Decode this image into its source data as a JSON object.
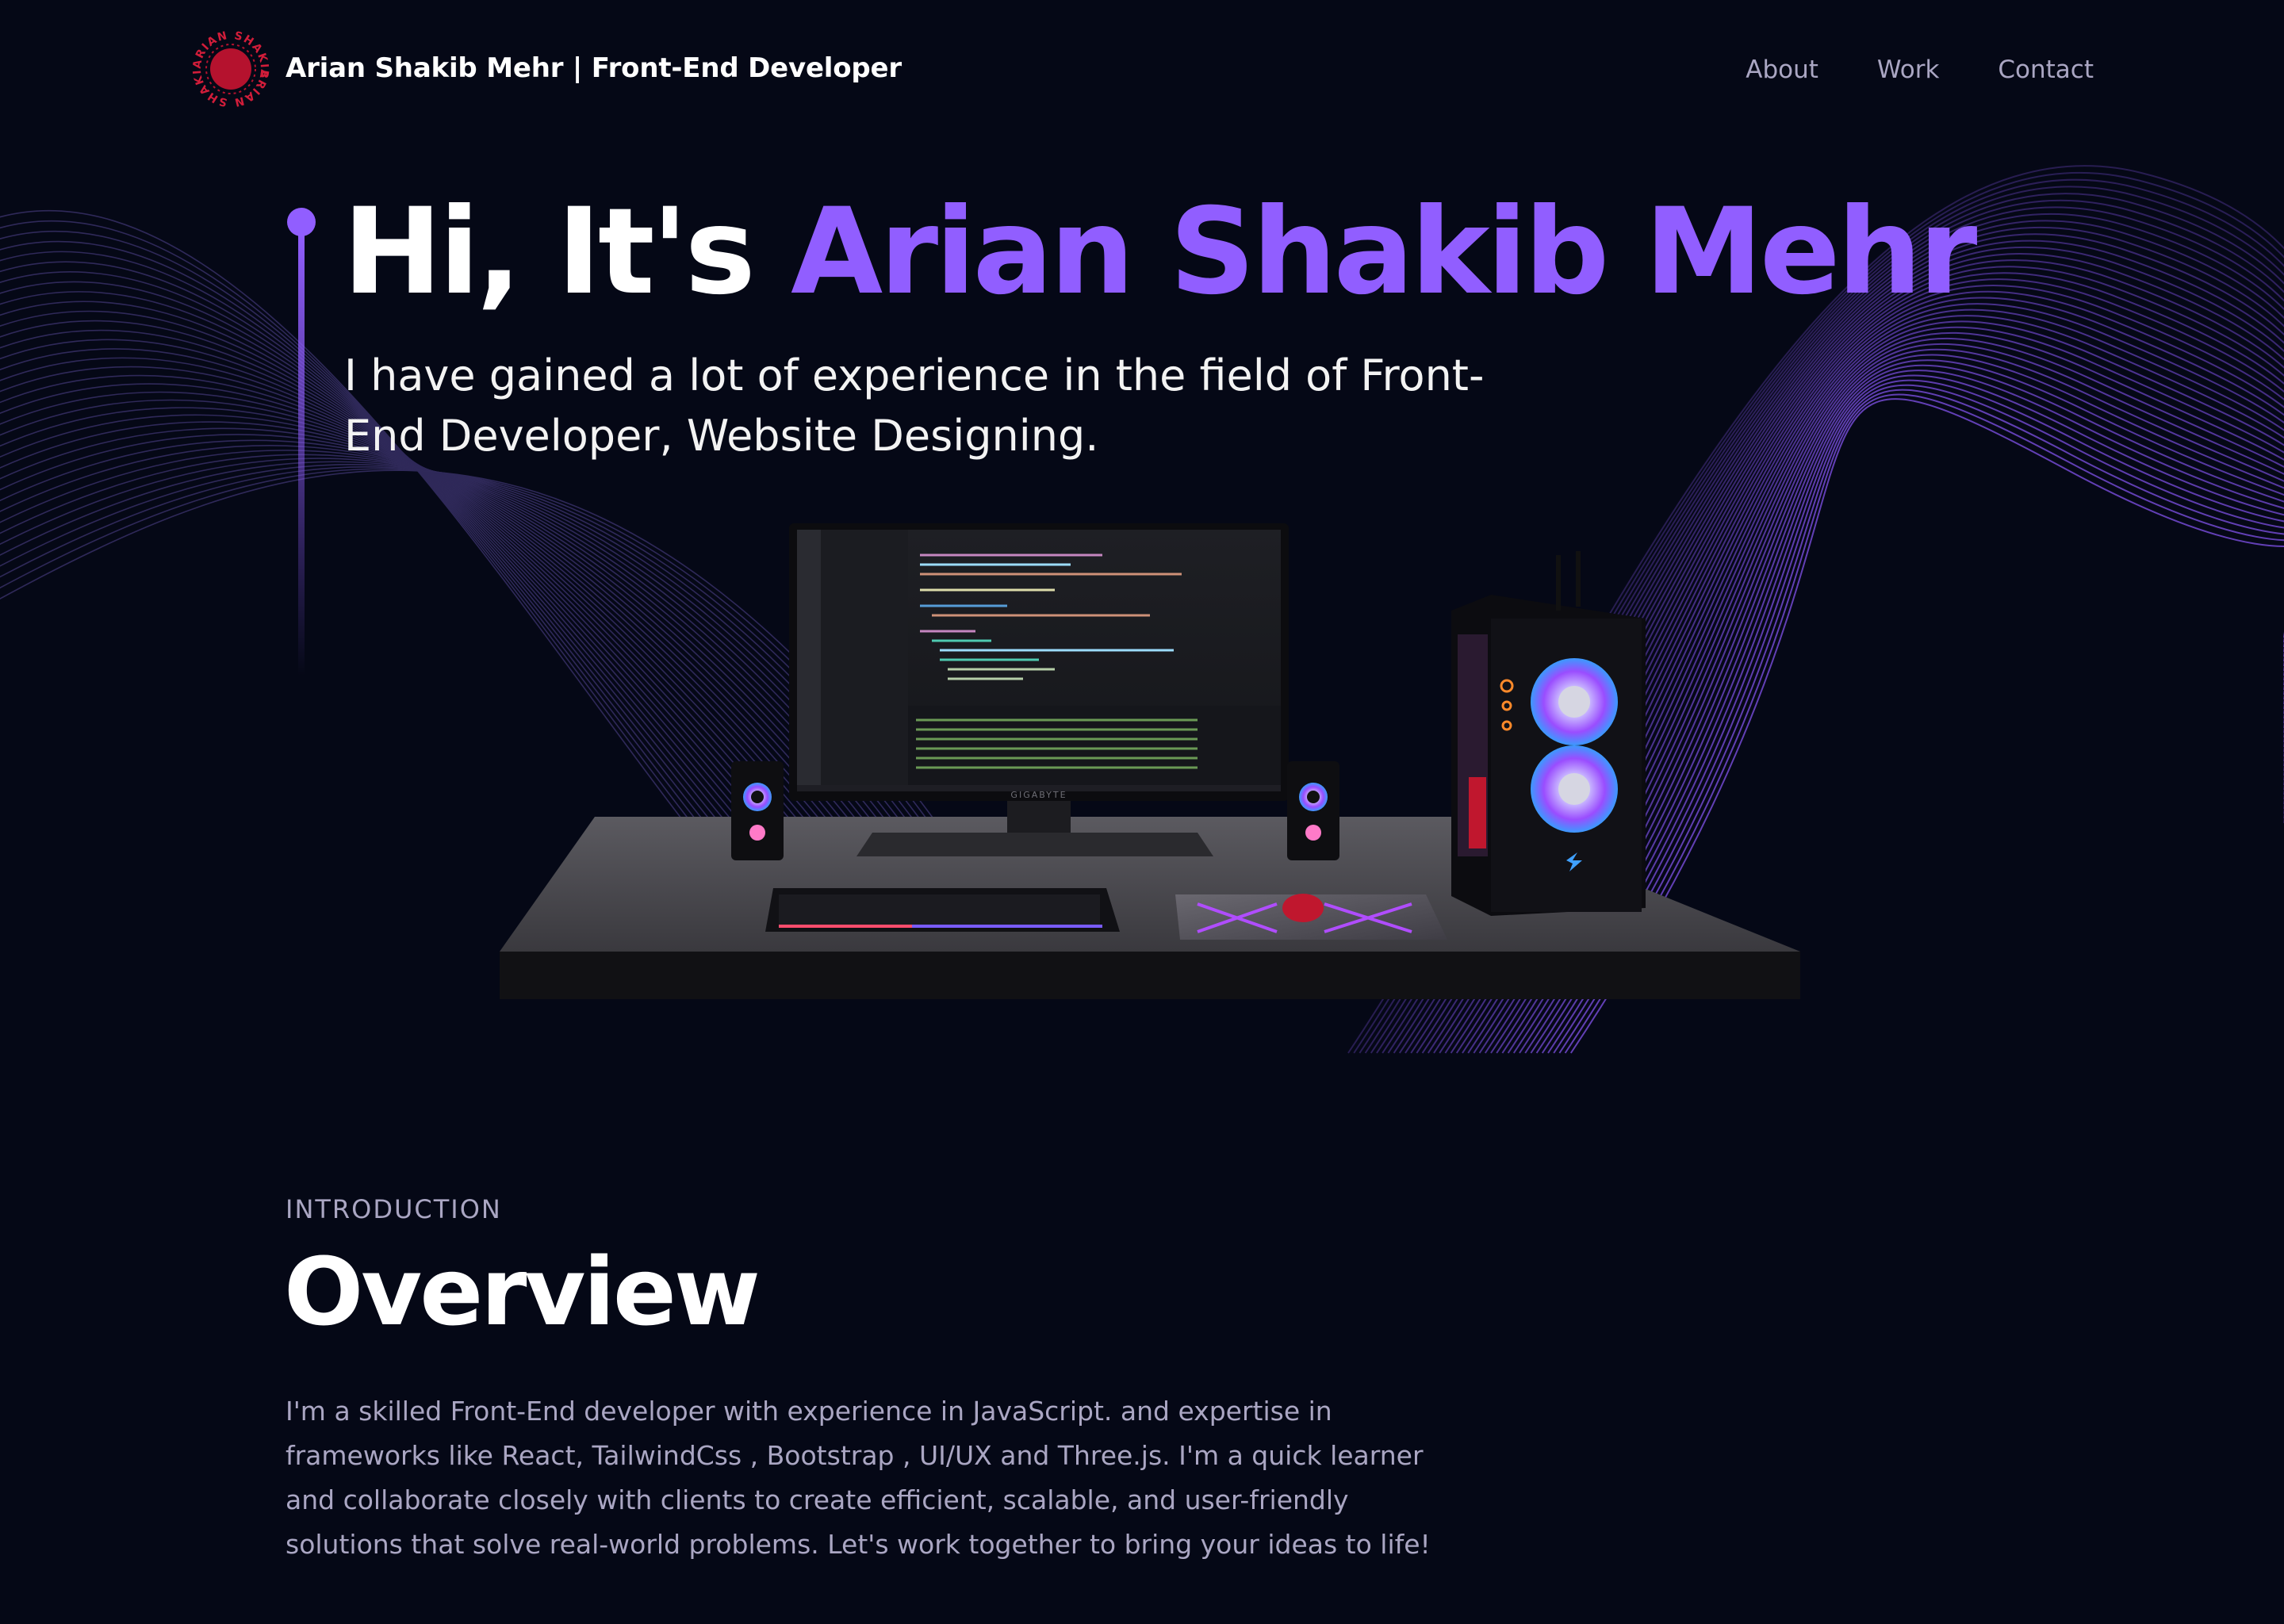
{
  "nav": {
    "logo_text": "ARIAN SHAKIB",
    "brand": "Arian Shakib Mehr  | Front-End Developer",
    "links": [
      "About",
      "Work",
      "Contact"
    ]
  },
  "hero": {
    "greeting": "Hi, It's ",
    "name": "Arian Shakib Mehr",
    "subtitle": "I have gained a lot of experience in the field of Front-End Developer, Website Designing."
  },
  "scene": {
    "monitor_brand": "GIGABYTE"
  },
  "intro": {
    "label": "INTRODUCTION",
    "title": "Overview",
    "text": "I'm a skilled Front-End developer with experience in JavaScript. and expertise in frameworks like React, TailwindCss , Bootstrap , UI/UX and Three.js. I'm a quick learner and collaborate closely with clients to create efficient, scalable, and user-friendly solutions that solve real-world problems. Let's work together to bring your ideas to life!"
  },
  "colors": {
    "background": "#050816",
    "accent": "#915eff",
    "secondary_text": "#aaa6c3",
    "logo_red": "#c41e3a"
  }
}
